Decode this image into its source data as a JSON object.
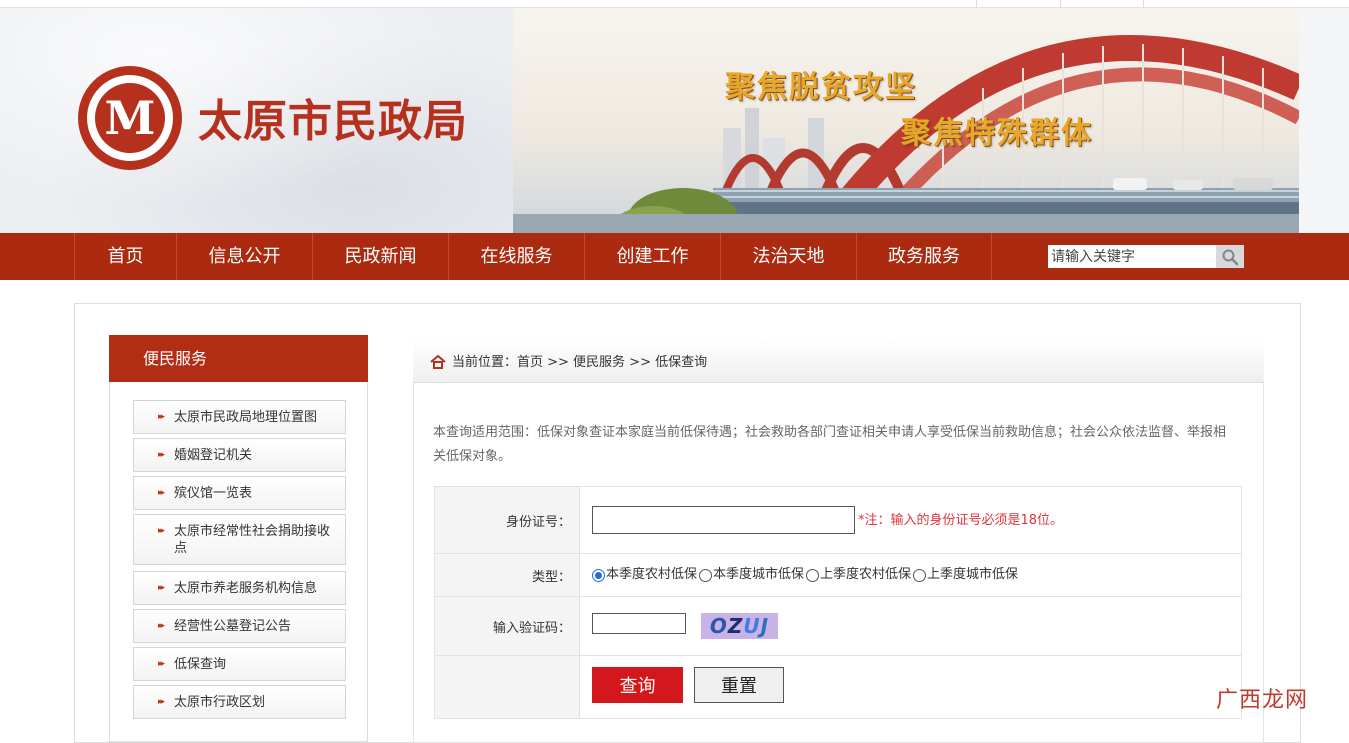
{
  "header": {
    "site_title": "太原市民政局",
    "emblem_glyph": "M",
    "slogan_1": "聚焦脱贫攻坚",
    "slogan_2": "聚焦特殊群体",
    "brand_color": "#b5311d"
  },
  "nav": {
    "items": [
      "首页",
      "信息公开",
      "民政新闻",
      "在线服务",
      "创建工作",
      "法治天地",
      "政务服务"
    ],
    "search_placeholder": "请输入关键字",
    "background_color": "#ab2a10"
  },
  "sidebar": {
    "title": "便民服务",
    "items": [
      "太原市民政局地理位置图",
      "婚姻登记机关",
      "殡仪馆一览表",
      "太原市经常性社会捐助接收点",
      "太原市养老服务机构信息",
      "经营性公墓登记公告",
      "低保查询",
      "太原市行政区划"
    ]
  },
  "breadcrumb": {
    "text": "当前位置：首页 >> 便民服务 >> 低保查询"
  },
  "content": {
    "description": "本查询适用范围：低保对象查证本家庭当前低保待遇；社会救助各部门查证相关申请人享受低保当前救助信息；社会公众依法监督、举报相关低保对象。",
    "form": {
      "id_label": "身份证号：",
      "id_value": "",
      "id_note": "*注：输入的身份证号必须是18位。",
      "type_label": "类型：",
      "type_options": [
        "本季度农村低保",
        "本季度城市低保",
        "上季度农村低保",
        "上季度城市低保"
      ],
      "type_selected": "本季度农村低保",
      "captcha_label": "输入验证码：",
      "captcha_value": "",
      "captcha_text": [
        "O",
        "Z",
        "U",
        "J"
      ],
      "query_button": "查询",
      "reset_button": "重置"
    }
  },
  "watermark": {
    "text": "广西龙网"
  }
}
